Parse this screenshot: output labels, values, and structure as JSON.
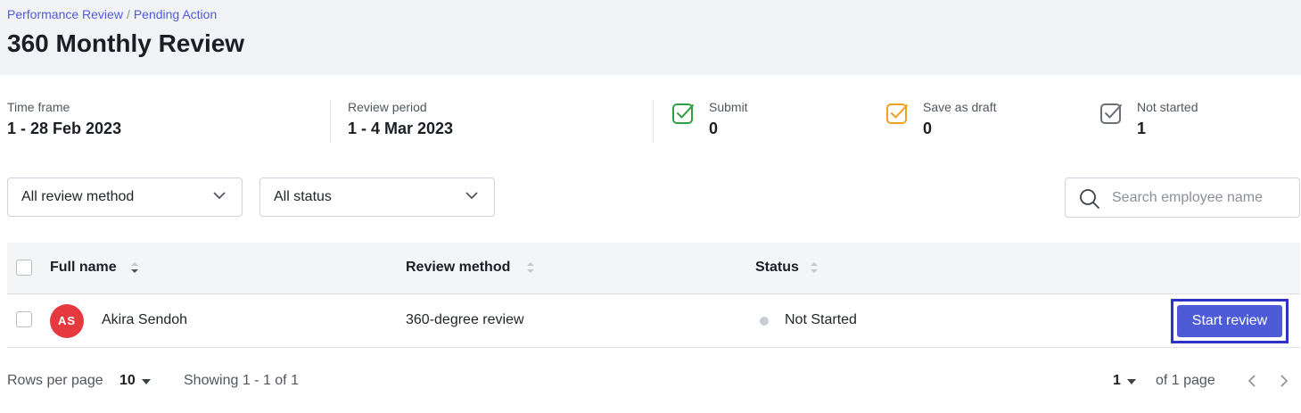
{
  "breadcrumb": {
    "items": [
      "Performance Review",
      "Pending Action"
    ],
    "separator": "/"
  },
  "page": {
    "title": "360 Monthly Review"
  },
  "stats": {
    "time_frame": {
      "label": "Time frame",
      "value": "1 - 28 Feb 2023"
    },
    "review_period": {
      "label": "Review period",
      "value": "1 - 4 Mar 2023"
    },
    "submit": {
      "label": "Submit",
      "value": "0",
      "icon": "check-square-icon",
      "color": "#2ea043"
    },
    "draft": {
      "label": "Save as draft",
      "value": "0",
      "icon": "check-square-icon",
      "color": "#f0a020"
    },
    "not_started": {
      "label": "Not started",
      "value": "1",
      "icon": "check-square-icon",
      "color": "#6b7078"
    }
  },
  "filters": {
    "review_method": {
      "selected": "All review method"
    },
    "status": {
      "selected": "All status"
    },
    "search": {
      "placeholder": "Search employee name",
      "value": ""
    }
  },
  "table": {
    "columns": [
      "Full name",
      "Review method",
      "Status"
    ],
    "rows": [
      {
        "initials": "AS",
        "name": "Akira Sendoh",
        "method": "360-degree review",
        "status": "Not Started",
        "action": "Start review"
      }
    ]
  },
  "footer": {
    "rows_per_page_label": "Rows per page",
    "rows_per_page": "10",
    "showing": "Showing 1 - 1 of 1",
    "current_page": "1",
    "of_pages": "of 1 page"
  },
  "colors": {
    "accent": "#4e5bd6",
    "avatar": "#e5393f",
    "header_bg": "#f2f3f6"
  }
}
